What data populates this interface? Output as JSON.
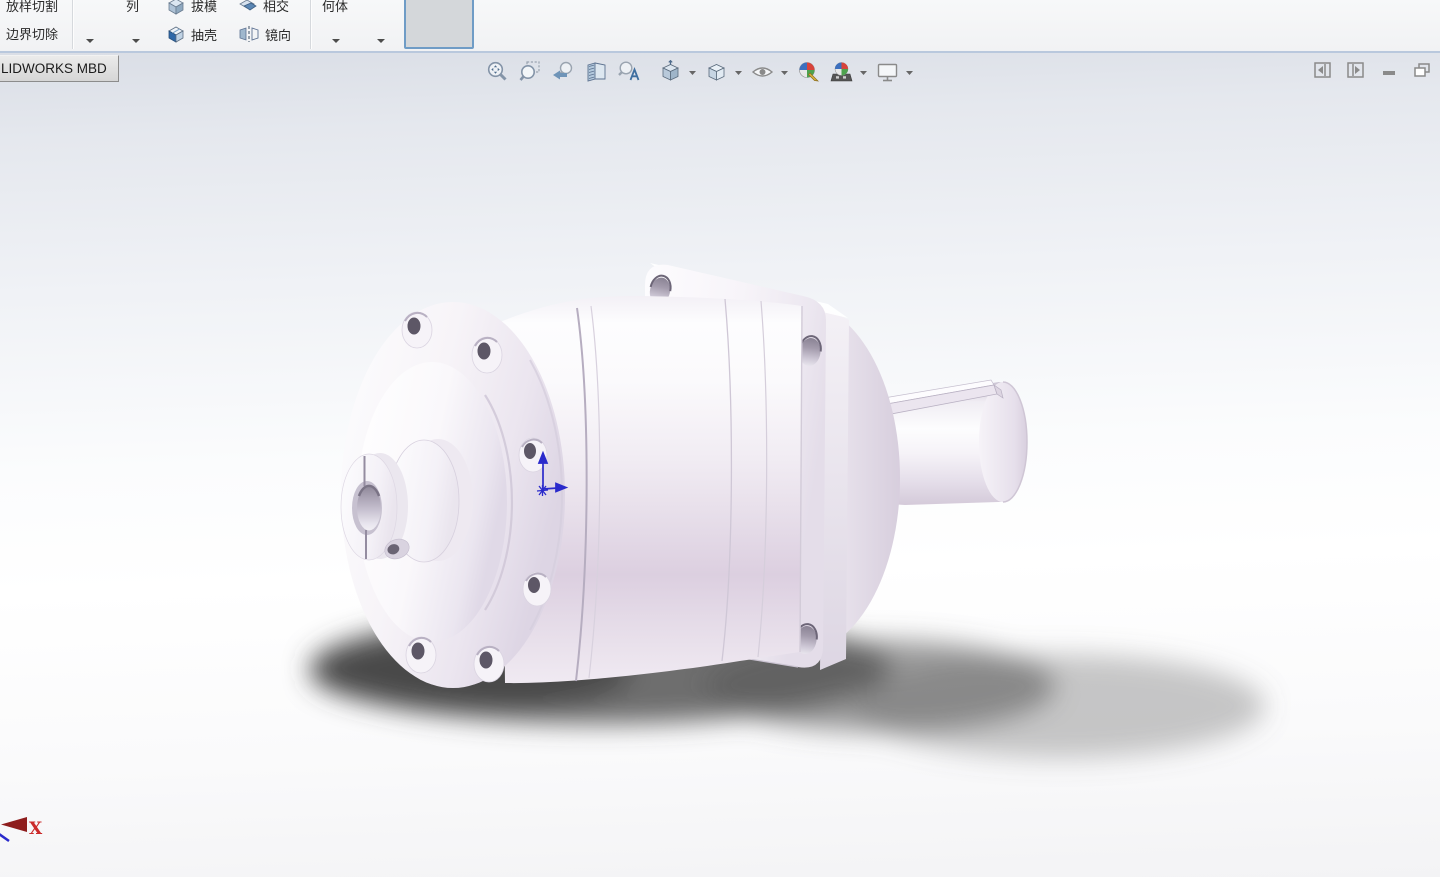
{
  "window": {
    "tab_label": "LIDWORKS MBD",
    "controls": [
      "collapse-pane-left",
      "collapse-pane-right",
      "minimize",
      "restore"
    ]
  },
  "command_manager": {
    "buttons": {
      "lofted_cut": "放样切割",
      "boundary_cut": "边界切除",
      "pattern_partial": "列",
      "draft": "拔模",
      "shell": "抽壳",
      "intersect": "相交",
      "mirror": "镜向",
      "reference_geometry_partial": "何体"
    }
  },
  "heads_up_toolbar": {
    "icons": [
      "zoom-to-fit",
      "zoom-to-area",
      "previous-view",
      "section-view",
      "dynamic-annotation-views",
      "view-orientation",
      "display-style",
      "hide-show-items",
      "edit-appearance",
      "apply-scene",
      "view-settings"
    ]
  },
  "viewport": {
    "model": "planetary-gearbox-3d-model",
    "origin_marker": "part-origin",
    "triad": {
      "x_label": "X"
    }
  },
  "colors": {
    "toolbar_bg": "#f5f6f7",
    "toolbar_border": "#b9c8dd",
    "active_tool_border": "#6f9cc6",
    "tab_bg": "#dcdcdc",
    "viewport_top": "#dadee6",
    "viewport_bottom": "#f3f3f5",
    "model_shade_lavender": "#dccfe0",
    "origin_blue": "#2a2acb",
    "triad_red": "#cb2a2a",
    "shadow_gray": "#4e4e4e"
  }
}
